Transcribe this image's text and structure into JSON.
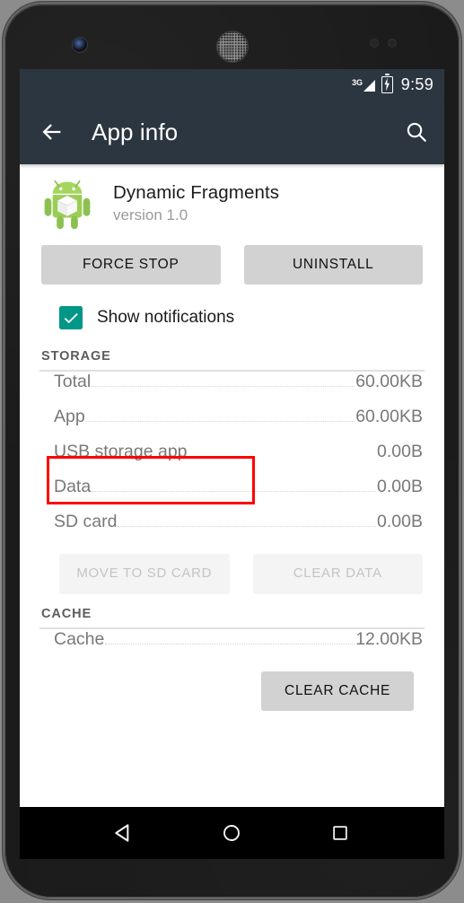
{
  "device": {
    "hardware": {
      "front_camera": "front-camera",
      "earpiece": "earpiece-speaker",
      "proximity_sensor": "proximity-sensor",
      "light_sensor": "light-sensor"
    }
  },
  "status_bar": {
    "network_label": "3G",
    "signal_icon": "signal-triangle-icon",
    "battery_icon": "battery-charging-icon",
    "clock": "9:59"
  },
  "action_bar": {
    "back_icon": "back-arrow-icon",
    "title": "App info",
    "search_icon": "search-icon"
  },
  "app_header": {
    "icon": "android-robot-icon",
    "name": "Dynamic Fragments",
    "version": "version 1.0"
  },
  "top_buttons": [
    {
      "label": "FORCE STOP",
      "enabled": true,
      "name": "force-stop-button"
    },
    {
      "label": "UNINSTALL",
      "enabled": true,
      "name": "uninstall-button"
    }
  ],
  "notifications": {
    "label": "Show notifications",
    "checked": true,
    "checkbox_color": "#009688",
    "check_icon": "checkmark-icon",
    "highlight_color": "#ff0000"
  },
  "storage": {
    "section_title": "STORAGE",
    "rows": [
      {
        "label": "Total",
        "value": "60.00KB",
        "leader": true
      },
      {
        "label": "App",
        "value": "60.00KB",
        "leader": true
      },
      {
        "label": "USB storage app",
        "value": "0.00B",
        "leader": false
      },
      {
        "label": "Data",
        "value": "0.00B",
        "leader": true
      },
      {
        "label": "SD card",
        "value": "0.00B",
        "leader": true
      }
    ],
    "buttons": [
      {
        "label": "MOVE TO SD CARD",
        "enabled": false,
        "name": "move-to-sd-card-button"
      },
      {
        "label": "CLEAR DATA",
        "enabled": false,
        "name": "clear-data-button"
      }
    ]
  },
  "cache": {
    "section_title": "CACHE",
    "rows": [
      {
        "label": "Cache",
        "value": "12.00KB",
        "leader": true
      }
    ],
    "buttons": [
      {
        "label": "CLEAR CACHE",
        "enabled": true,
        "name": "clear-cache-button"
      }
    ]
  },
  "nav_bar": {
    "back": "nav-back-icon",
    "home": "nav-home-icon",
    "recents": "nav-recents-icon"
  },
  "theme": {
    "toolbar_bg": "#2b3640",
    "accent": "#009688",
    "button_bg": "#d2d2d2",
    "disabled_text": "#c4c4c4",
    "body_text": "#787878"
  }
}
